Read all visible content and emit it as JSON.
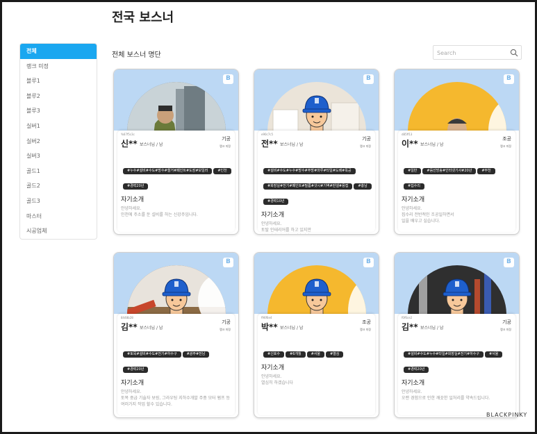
{
  "page": {
    "title": "전국 보스너",
    "section_title": "전체 보스너 명단",
    "brand": "BLACKPINKY"
  },
  "search": {
    "placeholder": "Search"
  },
  "sidebar": {
    "items": [
      {
        "label": "전체",
        "active": true
      },
      {
        "label": "랭크 미정"
      },
      {
        "label": "블루1"
      },
      {
        "label": "블루2"
      },
      {
        "label": "블루3"
      },
      {
        "label": "실버1"
      },
      {
        "label": "실버2"
      },
      {
        "label": "실버3"
      },
      {
        "label": "골드1"
      },
      {
        "label": "골드2"
      },
      {
        "label": "골드3"
      },
      {
        "label": "마스터"
      },
      {
        "label": "시공업체"
      }
    ]
  },
  "colors": {
    "accent": "#1aa7f0",
    "card_top": "#bcd8f4",
    "tag_bg": "#2b2b2b",
    "worker_blue": "#1e5fcc",
    "yellow_bg": "#f5b82e"
  },
  "cards": [
    {
      "id": "%67f5c3c",
      "name": "신**",
      "role": "보스너님 / 남",
      "grade": "기공",
      "rank": "랭크 미정",
      "tags": [
        "#누수#설비#수도#방수#철거#페인트#도장#보일러",
        "#인천",
        "#경력20년"
      ],
      "intro_title": "자기소개",
      "intro": "안녕하세요.\n인천에 주소를 둔 설비를 하는 신강주입니다.",
      "avatar": "photo-worker"
    },
    {
      "id": "e90c7c5",
      "name": "전**",
      "role": "보스너님 / 남",
      "grade": "기공",
      "rank": "랭크 미정",
      "tags": [
        "#설비#수도#누수#방수#주방#마루#타일#도배#목공",
        "#화장실#전기#페인트#필름#샷시#기벽#판넬#용접",
        "#충남",
        "#경력10년"
      ],
      "intro_title": "자기소개",
      "intro": "안녕하세요.\n토탈 인테리어를 하고 있지만\n부분적인 일도하고 있습니다.\n부담 없이 연락 주세요",
      "avatar": "avatar-room"
    },
    {
      "id": "d85ff13",
      "name": "이**",
      "role": "보스너님 / 남",
      "grade": "조공",
      "rank": "랭크 미정",
      "tags": [
        "#일반",
        "#음선방송#인터넷기사#20년",
        "#부천",
        "#집수리"
      ],
      "intro_title": "자기소개",
      "intro": "안녕하세요.\n집수리 전반적인 조공일하면서\n일을 배우고 싶습니다.",
      "avatar": "photo-man"
    },
    {
      "id": "8448b28",
      "name": "김**",
      "role": "보스너님 / 남",
      "grade": "기공",
      "rank": "랭크 미정",
      "tags": [
        "#토목#설비#수도#전기#하수구",
        "#광주#전남",
        "#경력20년"
      ],
      "intro_title": "자기소개",
      "intro": "안녕하세요.\n토목 중급 기술자 보링, 그라우팅 지하수개발 주중 모터 펌프 등 여러가지 작업 할수 있습니다.",
      "avatar": "avatar-wood"
    },
    {
      "id": "f96f6e4",
      "name": "박**",
      "role": "보스너님 / 남",
      "grade": "조공",
      "rank": "랭크 미정",
      "tags": [
        "#신호수",
        "#6개월",
        "#서울",
        "#열심"
      ],
      "intro_title": "자기소개",
      "intro": "안녕하세요.\n열심히 하겠습니다",
      "avatar": "avatar-yellow"
    },
    {
      "id": "f0f6ce2",
      "name": "김**",
      "role": "보스너님 / 남",
      "grade": "기공",
      "rank": "랭크 미정",
      "tags": [
        "#설비#수도#누수#타일#화장실#전기#하수구",
        "#서울",
        "#경력20년"
      ],
      "intro_title": "자기소개",
      "intro": "안녕하세요.\n오랜 경험으로 인한 깨끗한 일처리를 약속드립니다.",
      "avatar": "avatar-tools"
    }
  ]
}
